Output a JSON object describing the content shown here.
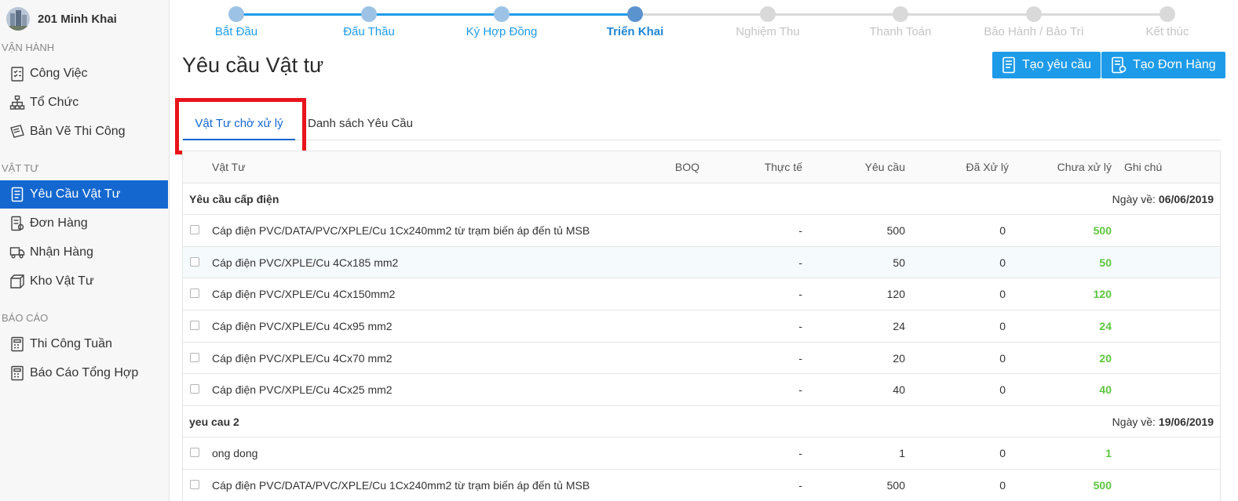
{
  "project": {
    "name": "201 Minh Khai"
  },
  "sidebar": {
    "sections": [
      {
        "title": "VẬN HÀNH",
        "items": [
          {
            "label": "Công Việc"
          },
          {
            "label": "Tổ Chức"
          },
          {
            "label": "Bản Vẽ Thi Công"
          }
        ]
      },
      {
        "title": "VẬT TƯ",
        "items": [
          {
            "label": "Yêu Cầu Vật Tư",
            "active": true
          },
          {
            "label": "Đơn Hàng"
          },
          {
            "label": "Nhận Hàng"
          },
          {
            "label": "Kho Vật Tư"
          }
        ]
      },
      {
        "title": "BÁO CÁO",
        "items": [
          {
            "label": "Thi Công Tuần"
          },
          {
            "label": "Báo Cáo Tổng Hợp"
          }
        ]
      }
    ]
  },
  "stepper": {
    "steps": [
      {
        "label": "Bắt Đầu",
        "state": "done"
      },
      {
        "label": "Đấu Thầu",
        "state": "done"
      },
      {
        "label": "Ký Hợp Đồng",
        "state": "done"
      },
      {
        "label": "Triển Khai",
        "state": "current"
      },
      {
        "label": "Nghiệm Thu",
        "state": "todo"
      },
      {
        "label": "Thanh Toán",
        "state": "todo"
      },
      {
        "label": "Bảo Hành / Bảo Trì",
        "state": "todo"
      },
      {
        "label": "Kết thúc",
        "state": "todo"
      }
    ],
    "colors": {
      "done": "#9cc3e6",
      "current": "#5b93cf",
      "todo": "#d9d9d9",
      "line_done": "#1e9be8"
    }
  },
  "page": {
    "title": "Yêu cầu Vật tư"
  },
  "actions": {
    "create_request": "Tạo yêu cầu",
    "create_order": "Tạo Đơn Hàng"
  },
  "tabs": [
    {
      "label": "Vật Tư chờ xử lý",
      "active": true
    },
    {
      "label": "Danh sách Yêu Cầu"
    }
  ],
  "table": {
    "headers": {
      "material": "Vật Tư",
      "boq": "BOQ",
      "actual": "Thực tế",
      "request": "Yêu cầu",
      "processed": "Đã Xử lý",
      "pending": "Chưa xử lý",
      "note": "Ghi chú"
    },
    "groups": [
      {
        "name": "Yêu cầu cấp điện",
        "date_label": "Ngày về:",
        "date": "06/06/2019",
        "rows": [
          {
            "material": "Cáp điện PVC/DATA/PVC/XPLE/Cu 1Cx240mm2 từ trạm biến áp đến tủ MSB",
            "actual": "-",
            "request": "500",
            "processed": "0",
            "pending": "500"
          },
          {
            "material": "Cáp điện PVC/XPLE/Cu 4Cx185 mm2",
            "actual": "-",
            "request": "50",
            "processed": "0",
            "pending": "50"
          },
          {
            "material": "Cáp điện PVC/XPLE/Cu 4Cx150mm2",
            "actual": "-",
            "request": "120",
            "processed": "0",
            "pending": "120"
          },
          {
            "material": "Cáp điện PVC/XPLE/Cu 4Cx95 mm2",
            "actual": "-",
            "request": "24",
            "processed": "0",
            "pending": "24"
          },
          {
            "material": "Cáp điện PVC/XPLE/Cu 4Cx70 mm2",
            "actual": "-",
            "request": "20",
            "processed": "0",
            "pending": "20"
          },
          {
            "material": "Cáp điện PVC/XPLE/Cu 4Cx25 mm2",
            "actual": "-",
            "request": "40",
            "processed": "0",
            "pending": "40"
          }
        ]
      },
      {
        "name": "yeu cau 2",
        "date_label": "Ngày về:",
        "date": "19/06/2019",
        "rows": [
          {
            "material": "ong dong",
            "actual": "-",
            "request": "1",
            "processed": "0",
            "pending": "1"
          },
          {
            "material": "Cáp điện PVC/DATA/PVC/XPLE/Cu 1Cx240mm2 từ trạm biến áp đến tủ MSB",
            "actual": "-",
            "request": "500",
            "processed": "0",
            "pending": "500"
          }
        ]
      }
    ]
  },
  "colors": {
    "primary": "#1467cf",
    "button": "#1e9be8",
    "pending_value": "#5cc63e",
    "highlight_box": "#e8141c"
  }
}
